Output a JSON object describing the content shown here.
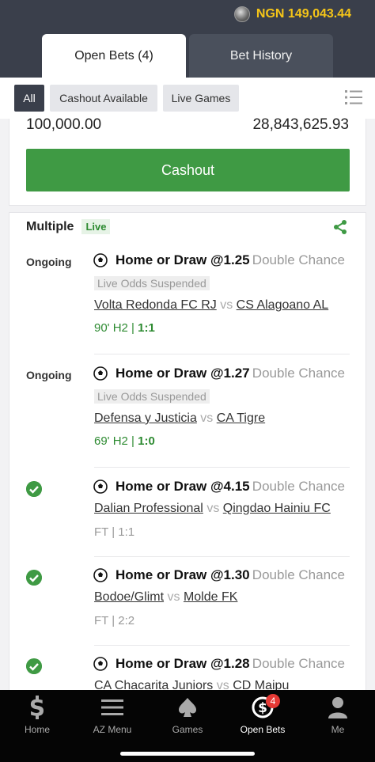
{
  "header": {
    "balance": "NGN 149,043.44",
    "tabs": [
      {
        "label": "Open Bets (4)",
        "active": true
      },
      {
        "label": "Bet History",
        "active": false
      }
    ]
  },
  "filters": {
    "items": [
      "All",
      "Cashout Available",
      "Live Games"
    ],
    "selected": "All"
  },
  "card1": {
    "stake": "100,000.00",
    "potential_win": "28,843,625.93",
    "cashout_label": "Cashout"
  },
  "card2": {
    "type": "Multiple",
    "live_badge": "Live",
    "legs": [
      {
        "status": "Ongoing",
        "selection": "Home or Draw @1.25",
        "market": "Double Chance",
        "suspended": "Live Odds Suspended",
        "home": "Volta Redonda FC RJ",
        "vs": "vs",
        "away": "CS Alagoano AL",
        "time": "90' H2 | ",
        "score": "1:1"
      },
      {
        "status": "Ongoing",
        "selection": "Home or Draw @1.27",
        "market": "Double Chance",
        "suspended": "Live Odds Suspended",
        "home": "Defensa y Justicia",
        "vs": "vs",
        "away": "CA Tigre",
        "time": "69' H2 | ",
        "score": "1:0"
      },
      {
        "status": "won",
        "selection": "Home or Draw @4.15",
        "market": "Double Chance",
        "home": "Dalian Professional",
        "vs": "vs",
        "away": "Qingdao Hainiu FC",
        "result": "FT | 1:1"
      },
      {
        "status": "won",
        "selection": "Home or Draw @1.30",
        "market": "Double Chance",
        "home": "Bodoe/Glimt",
        "vs": "vs",
        "away": "Molde FK",
        "result": "FT | 2:2"
      },
      {
        "status": "won",
        "selection": "Home or Draw @1.28",
        "market": "Double Chance",
        "home": "CA Chacarita Juniors",
        "vs": "vs",
        "away": "CD Maipu"
      }
    ]
  },
  "bottom_nav": {
    "items": [
      {
        "label": "Home",
        "icon": "dollar-s-icon"
      },
      {
        "label": "AZ Menu",
        "icon": "hamburger-icon"
      },
      {
        "label": "Games",
        "icon": "spade-icon"
      },
      {
        "label": "Open Bets",
        "icon": "open-bets-icon",
        "badge": "4",
        "active": true
      },
      {
        "label": "Me",
        "icon": "user-icon"
      }
    ]
  },
  "colors": {
    "header_bg": "#3a3f4b",
    "balance": "#f5c518",
    "cashout_green": "#3f9a44",
    "live_text": "#2e8b32",
    "nav_bg": "#050505",
    "badge_red": "#e53935"
  }
}
